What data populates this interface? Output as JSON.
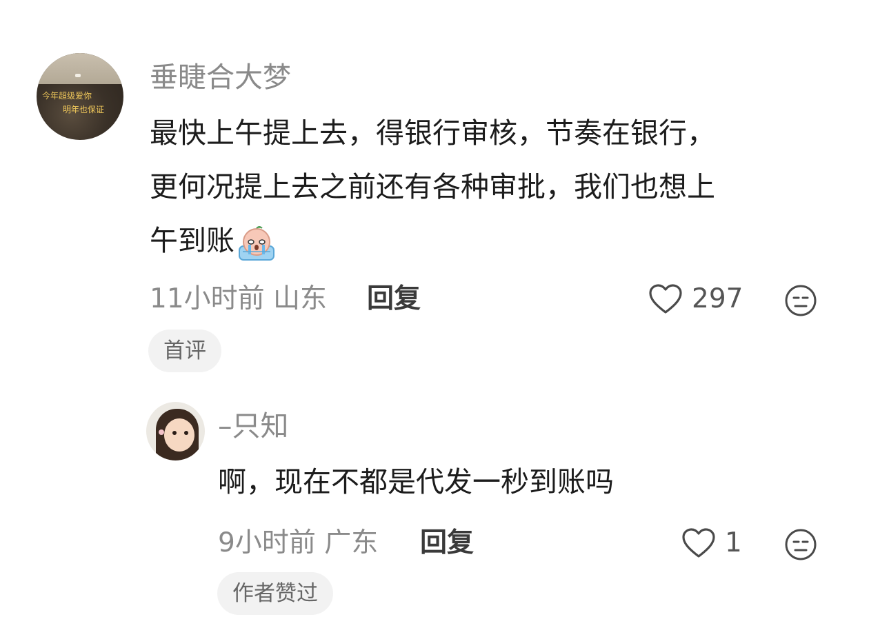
{
  "comments": [
    {
      "user": "垂睫合大梦",
      "avatar_text": [
        "今年超级爱你",
        "明年也保证"
      ],
      "text_lines": [
        "最快上午提上去，得银行审核，节奏在银行，",
        "更何况提上去之前还有各种审批，我们也想上",
        "午到账"
      ],
      "emoji": "crying-face-emoji",
      "time": "11小时前",
      "location": "山东",
      "reply_label": "回复",
      "likes": "297",
      "badge": "首评"
    },
    {
      "user": "–只知",
      "text": "啊，现在不都是代发一秒到账吗",
      "time": "9小时前",
      "location": "广东",
      "reply_label": "回复",
      "likes": "1",
      "badge": "作者赞过"
    }
  ],
  "icons": {
    "like": "heart-outline-icon",
    "dislike": "meh-face-icon"
  },
  "colors": {
    "muted_text": "#8a8a8a",
    "badge_bg": "#f2f2f2"
  }
}
